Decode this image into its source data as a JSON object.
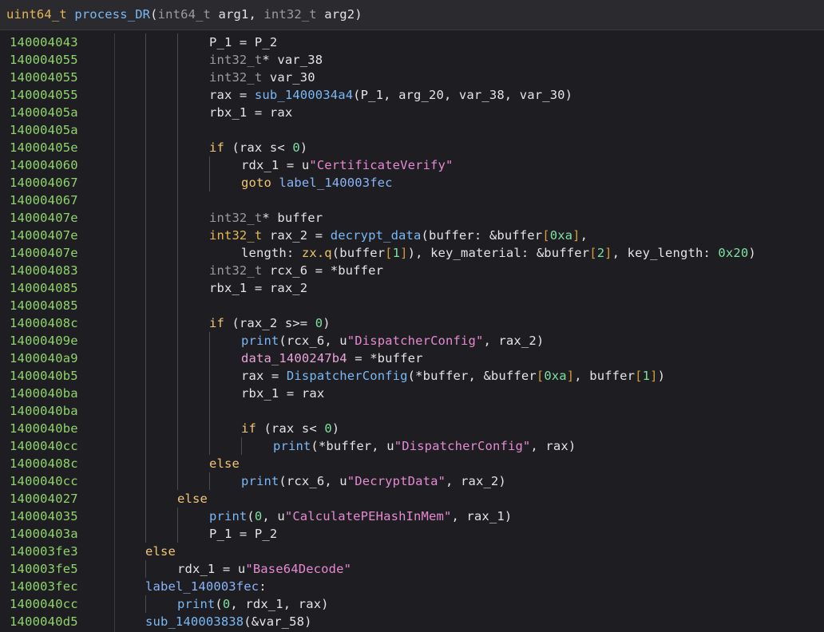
{
  "header": {
    "segments": [
      {
        "t": "uint64_t",
        "c": "t-type"
      },
      {
        "t": " ",
        "c": ""
      },
      {
        "t": "process_DR",
        "c": "t-func"
      },
      {
        "t": "(",
        "c": ""
      },
      {
        "t": "int64_t",
        "c": "t-type2"
      },
      {
        "t": " arg1, ",
        "c": ""
      },
      {
        "t": "int32_t",
        "c": "t-type2"
      },
      {
        "t": " arg2)",
        "c": ""
      }
    ]
  },
  "theme": {
    "background": "#1e1e22",
    "address_color": "#8fd46a",
    "keyword_color": "#f0c674",
    "function_color": "#79b8f5",
    "string_color": "#e58ad1",
    "number_color": "#7ee0a0"
  },
  "lines": [
    {
      "addr": "140004043",
      "indent": 3,
      "guides": [
        1,
        2
      ],
      "segs": [
        [
          "P_1 = P_2",
          ""
        ]
      ]
    },
    {
      "addr": "140004055",
      "indent": 3,
      "guides": [
        1,
        2
      ],
      "segs": [
        [
          "int32_t",
          "t-type2"
        ],
        [
          "* var_38",
          ""
        ]
      ]
    },
    {
      "addr": "140004055",
      "indent": 3,
      "guides": [
        1,
        2
      ],
      "segs": [
        [
          "int32_t",
          "t-type2"
        ],
        [
          " var_30",
          ""
        ]
      ]
    },
    {
      "addr": "140004055",
      "indent": 3,
      "guides": [
        1,
        2
      ],
      "segs": [
        [
          "rax = ",
          ""
        ],
        [
          "sub_1400034a4",
          "t-func"
        ],
        [
          "(P_1, arg_20, var_38, var_30)",
          ""
        ]
      ]
    },
    {
      "addr": "14000405a",
      "indent": 3,
      "guides": [
        1,
        2
      ],
      "segs": [
        [
          "rbx_1 = rax",
          ""
        ]
      ]
    },
    {
      "addr": "14000405a",
      "indent": 3,
      "guides": [
        1,
        2
      ],
      "segs": []
    },
    {
      "addr": "14000405e",
      "indent": 3,
      "guides": [
        1,
        2
      ],
      "segs": [
        [
          "if",
          "t-kw"
        ],
        [
          " (rax s< ",
          ""
        ],
        [
          "0",
          "t-num"
        ],
        [
          ")",
          ""
        ]
      ]
    },
    {
      "addr": "140004060",
      "indent": 4,
      "guides": [
        1,
        2,
        3
      ],
      "segs": [
        [
          "rdx_1 = u",
          ""
        ],
        [
          "\"CertificateVerify\"",
          "t-str"
        ]
      ]
    },
    {
      "addr": "140004067",
      "indent": 4,
      "guides": [
        1,
        2,
        3
      ],
      "segs": [
        [
          "goto",
          "t-kw"
        ],
        [
          " ",
          ""
        ],
        [
          "label_140003fec",
          "t-label"
        ]
      ]
    },
    {
      "addr": "140004067",
      "indent": 3,
      "guides": [
        1,
        2
      ],
      "segs": []
    },
    {
      "addr": "14000407e",
      "indent": 3,
      "guides": [
        1,
        2
      ],
      "segs": [
        [
          "int32_t",
          "t-type2"
        ],
        [
          "* buffer",
          ""
        ]
      ]
    },
    {
      "addr": "14000407e",
      "indent": 3,
      "guides": [
        1,
        2
      ],
      "segs": [
        [
          "int32_t",
          "t-type"
        ],
        [
          " rax_2 = ",
          ""
        ],
        [
          "decrypt_data",
          "t-func"
        ],
        [
          "(buffer: &buffer",
          ""
        ],
        [
          "[",
          "t-bracket"
        ],
        [
          "0xa",
          "t-num"
        ],
        [
          "]",
          "t-bracket"
        ],
        [
          ",",
          ""
        ]
      ]
    },
    {
      "addr": "14000407e",
      "indent": 4,
      "guides": [
        1,
        2
      ],
      "segs": [
        [
          "length: ",
          ""
        ],
        [
          "zx.q",
          "t-ctor"
        ],
        [
          "(buffer",
          ""
        ],
        [
          "[",
          "t-bracket"
        ],
        [
          "1",
          "t-num"
        ],
        [
          "]",
          "t-bracket"
        ],
        [
          "), key_material: &buffer",
          ""
        ],
        [
          "[",
          "t-bracket"
        ],
        [
          "2",
          "t-num"
        ],
        [
          "]",
          "t-bracket"
        ],
        [
          ", key_length: ",
          ""
        ],
        [
          "0x20",
          "t-num"
        ],
        [
          ")",
          ""
        ]
      ]
    },
    {
      "addr": "140004083",
      "indent": 3,
      "guides": [
        1,
        2
      ],
      "segs": [
        [
          "int32_t",
          "t-type2"
        ],
        [
          " rcx_6 = *buffer",
          ""
        ]
      ]
    },
    {
      "addr": "140004085",
      "indent": 3,
      "guides": [
        1,
        2
      ],
      "segs": [
        [
          "rbx_1 = rax_2",
          ""
        ]
      ]
    },
    {
      "addr": "140004085",
      "indent": 3,
      "guides": [
        1,
        2
      ],
      "segs": []
    },
    {
      "addr": "14000408c",
      "indent": 3,
      "guides": [
        1,
        2
      ],
      "segs": [
        [
          "if",
          "t-kw"
        ],
        [
          " (rax_2 s>= ",
          ""
        ],
        [
          "0",
          "t-num"
        ],
        [
          ")",
          ""
        ]
      ]
    },
    {
      "addr": "14000409e",
      "indent": 4,
      "guides": [
        1,
        2,
        3
      ],
      "segs": [
        [
          "print",
          "t-func"
        ],
        [
          "(rcx_6, u",
          ""
        ],
        [
          "\"DispatcherConfig\"",
          "t-str"
        ],
        [
          ", rax_2)",
          ""
        ]
      ]
    },
    {
      "addr": "1400040a9",
      "indent": 4,
      "guides": [
        1,
        2,
        3
      ],
      "segs": [
        [
          "data_1400247b4",
          "t-data"
        ],
        [
          " = *buffer",
          ""
        ]
      ]
    },
    {
      "addr": "1400040b5",
      "indent": 4,
      "guides": [
        1,
        2,
        3
      ],
      "segs": [
        [
          "rax = ",
          ""
        ],
        [
          "DispatcherConfig",
          "t-func"
        ],
        [
          "(*buffer, &buffer",
          ""
        ],
        [
          "[",
          "t-bracket"
        ],
        [
          "0xa",
          "t-num"
        ],
        [
          "]",
          "t-bracket"
        ],
        [
          ", buffer",
          ""
        ],
        [
          "[",
          "t-bracket"
        ],
        [
          "1",
          "t-num"
        ],
        [
          "]",
          "t-bracket"
        ],
        [
          ")",
          ""
        ]
      ]
    },
    {
      "addr": "1400040ba",
      "indent": 4,
      "guides": [
        1,
        2,
        3
      ],
      "segs": [
        [
          "rbx_1 = rax",
          ""
        ]
      ]
    },
    {
      "addr": "1400040ba",
      "indent": 4,
      "guides": [
        1,
        2,
        3
      ],
      "segs": []
    },
    {
      "addr": "1400040be",
      "indent": 4,
      "guides": [
        1,
        2,
        3
      ],
      "segs": [
        [
          "if",
          "t-kw"
        ],
        [
          " (rax s< ",
          ""
        ],
        [
          "0",
          "t-num"
        ],
        [
          ")",
          ""
        ]
      ]
    },
    {
      "addr": "1400040cc",
      "indent": 5,
      "guides": [
        1,
        2,
        3,
        4
      ],
      "segs": [
        [
          "print",
          "t-func"
        ],
        [
          "(*buffer, u",
          ""
        ],
        [
          "\"DispatcherConfig\"",
          "t-str"
        ],
        [
          ", rax)",
          ""
        ]
      ]
    },
    {
      "addr": "14000408c",
      "indent": 3,
      "guides": [
        1,
        2
      ],
      "segs": [
        [
          "else",
          "t-kw"
        ]
      ]
    },
    {
      "addr": "1400040cc",
      "indent": 4,
      "guides": [
        1,
        2,
        3
      ],
      "segs": [
        [
          "print",
          "t-func"
        ],
        [
          "(rcx_6, u",
          ""
        ],
        [
          "\"DecryptData\"",
          "t-str"
        ],
        [
          ", rax_2)",
          ""
        ]
      ]
    },
    {
      "addr": "140004027",
      "indent": 2,
      "guides": [
        1
      ],
      "segs": [
        [
          "else",
          "t-kw"
        ]
      ]
    },
    {
      "addr": "140004035",
      "indent": 3,
      "guides": [
        1,
        2
      ],
      "segs": [
        [
          "print",
          "t-func"
        ],
        [
          "(",
          ""
        ],
        [
          "0",
          "t-num"
        ],
        [
          ", u",
          ""
        ],
        [
          "\"CalculatePEHashInMem\"",
          "t-str"
        ],
        [
          ", rax_1)",
          ""
        ]
      ]
    },
    {
      "addr": "14000403a",
      "indent": 3,
      "guides": [
        1,
        2
      ],
      "segs": [
        [
          "P_1 = P_2",
          ""
        ]
      ]
    },
    {
      "addr": "140003fe3",
      "indent": 1,
      "guides": [],
      "segs": [
        [
          "else",
          "t-kw"
        ]
      ]
    },
    {
      "addr": "140003fe5",
      "indent": 2,
      "guides": [
        1
      ],
      "segs": [
        [
          "rdx_1 = u",
          ""
        ],
        [
          "\"Base64Decode\"",
          "t-str"
        ]
      ]
    },
    {
      "addr": "140003fec",
      "indent": 1,
      "guides": [],
      "segs": [
        [
          "label_140003fec",
          "t-label"
        ],
        [
          ":",
          ""
        ]
      ]
    },
    {
      "addr": "1400040cc",
      "indent": 2,
      "guides": [
        1
      ],
      "segs": [
        [
          "print",
          "t-func"
        ],
        [
          "(",
          ""
        ],
        [
          "0",
          "t-num"
        ],
        [
          ", rdx_1, rax)",
          ""
        ]
      ]
    },
    {
      "addr": "1400040d5",
      "indent": 1,
      "guides": [],
      "segs": [
        [
          "sub_140003838",
          "t-func"
        ],
        [
          "(&var_58)",
          ""
        ]
      ]
    }
  ]
}
